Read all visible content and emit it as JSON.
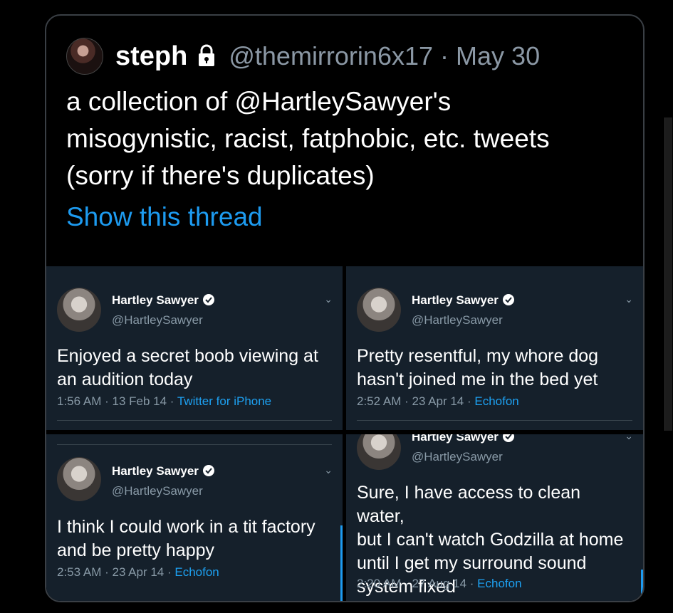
{
  "post": {
    "name": "steph",
    "handle": "@themirrorin6x17",
    "separator": "·",
    "date": "May 30",
    "text_lines": [
      "a collection of @HartleySawyer's",
      "misogynistic, racist, fatphobic, etc. tweets",
      "(sorry if there's duplicates)"
    ],
    "thread_link": "Show this thread"
  },
  "tweets": [
    {
      "name": "Hartley Sawyer",
      "handle": "@HartleySawyer",
      "text_lines": [
        "Enjoyed a secret boob viewing at",
        "an audition today"
      ],
      "time": "1:56 AM",
      "date": "13 Feb 14",
      "source": "Twitter for iPhone"
    },
    {
      "name": "Hartley Sawyer",
      "handle": "@HartleySawyer",
      "text_lines": [
        "Pretty resentful, my whore dog",
        "hasn't joined me in the bed yet"
      ],
      "time": "2:52 AM",
      "date": "23 Apr 14",
      "source": "Echofon"
    },
    {
      "name": "Hartley Sawyer",
      "handle": "@HartleySawyer",
      "text_lines": [
        "I think I could work in a tit factory",
        "and be pretty happy"
      ],
      "time": "2:53 AM",
      "date": "23 Apr 14",
      "source": "Echofon"
    },
    {
      "name": "Hartley Sawyer",
      "handle": "@HartleySawyer",
      "text_lines": [
        "Sure, I have access to clean water,",
        "but I can't watch Godzilla at home",
        "until I get my surround sound",
        "system fixed"
      ],
      "time": "2:20 AM",
      "date": "27 Aug 14",
      "source": "Echofon"
    }
  ],
  "meta_separator": " · ",
  "colors": {
    "link": "#1d9bf0",
    "panel_bg": "#15202b",
    "muted": "#8899a6"
  }
}
